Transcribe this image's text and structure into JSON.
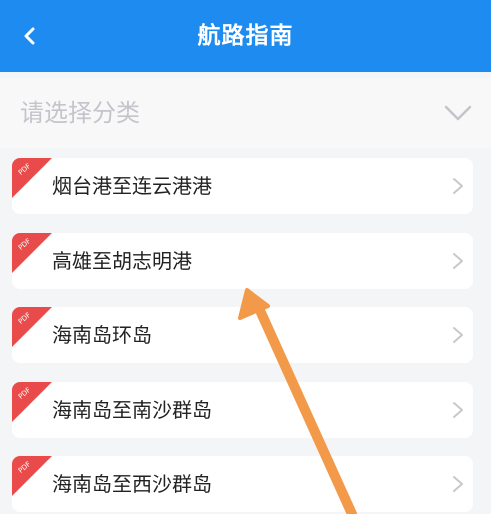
{
  "header": {
    "title": "航路指南",
    "back_icon": "chevron-left-icon"
  },
  "selector": {
    "placeholder": "请选择分类",
    "icon": "chevron-down-icon"
  },
  "list": {
    "badge_text": "PDF",
    "items": [
      {
        "label": "烟台港至连云港港"
      },
      {
        "label": "高雄至胡志明港"
      },
      {
        "label": "海南岛环岛"
      },
      {
        "label": "海南岛至南沙群岛"
      },
      {
        "label": "海南岛至西沙群岛"
      }
    ]
  },
  "colors": {
    "header_bg": "#1e8bf0",
    "badge": "#e94b4b",
    "annotation_arrow": "#f29a4a"
  }
}
